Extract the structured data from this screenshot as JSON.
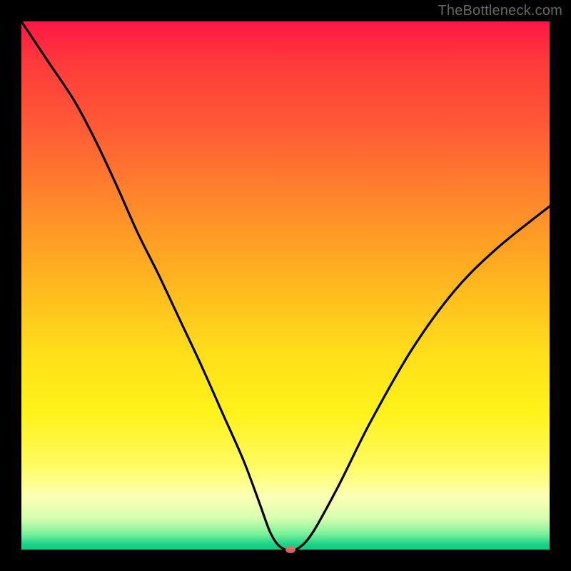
{
  "watermark": "TheBottleneck.com",
  "chart_data": {
    "type": "line",
    "title": "",
    "xlabel": "",
    "ylabel": "",
    "xlim": [
      0,
      100
    ],
    "ylim": [
      0,
      100
    ],
    "background_gradient": {
      "direction": "top-to-bottom",
      "stops": [
        {
          "pos": 0,
          "color": "#ff1744"
        },
        {
          "pos": 50,
          "color": "#ffe11a"
        },
        {
          "pos": 90,
          "color": "#fcffb5"
        },
        {
          "pos": 99,
          "color": "#18d38b"
        }
      ]
    },
    "series": [
      {
        "name": "bottleneck-curve",
        "color": "#000000",
        "x": [
          0,
          5,
          10,
          14,
          18,
          22,
          26,
          30,
          34,
          38,
          42,
          45,
          47,
          48.5,
          50,
          52,
          55,
          60,
          66,
          74,
          82,
          90,
          100
        ],
        "y": [
          100,
          92.5,
          85,
          77.5,
          69,
          60,
          52,
          43.5,
          35,
          26,
          17,
          9,
          3.5,
          1,
          0,
          0,
          3,
          12,
          24,
          38,
          49,
          57,
          65
        ]
      }
    ],
    "marker": {
      "x": 51,
      "y": 0,
      "color": "#e46a6a"
    }
  }
}
